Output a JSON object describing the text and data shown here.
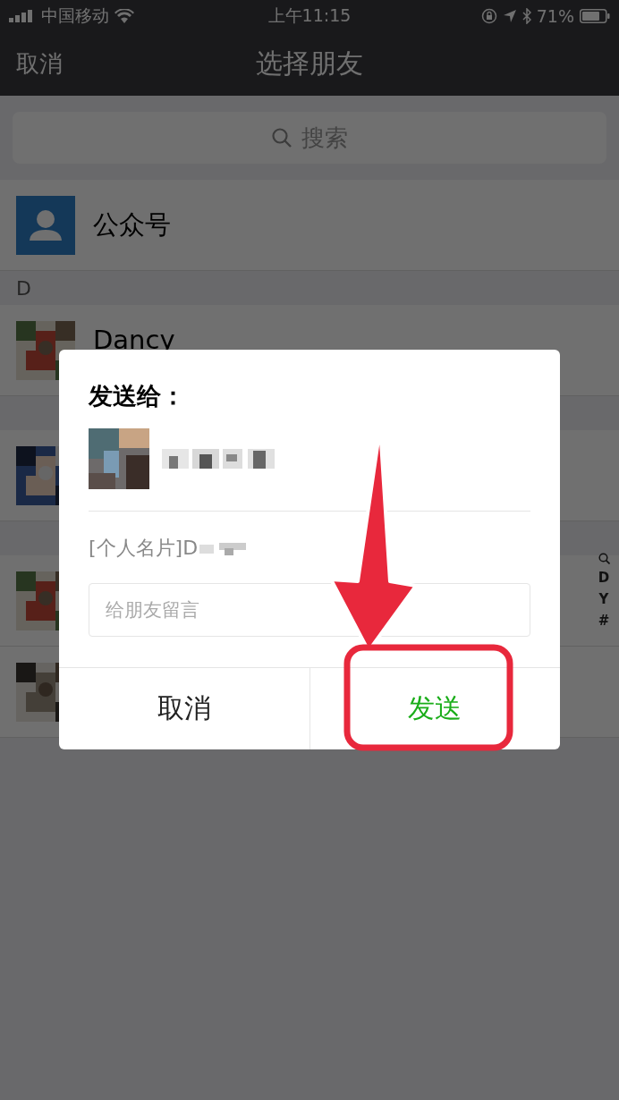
{
  "status_bar": {
    "carrier": "中国移动",
    "time": "上午11:15",
    "battery": "71%"
  },
  "nav": {
    "left": "取消",
    "title": "选择朋友"
  },
  "search": {
    "placeholder": "搜索"
  },
  "official_accounts": {
    "label": "公众号"
  },
  "list": [
    {
      "kind": "header",
      "label": "D"
    },
    {
      "kind": "contact",
      "name": "Dancy"
    },
    {
      "kind": "header"
    },
    {
      "kind": "contact"
    },
    {
      "kind": "header"
    },
    {
      "kind": "contact"
    },
    {
      "kind": "contact"
    }
  ],
  "index_bar": [
    "D",
    "Y",
    "#"
  ],
  "dialog": {
    "title": "发送给：",
    "card_text": "[个人名片]D",
    "message": {
      "placeholder": "给朋友留言"
    },
    "buttons": [
      {
        "kind": "cancel",
        "label": "取消"
      },
      {
        "kind": "confirm",
        "label": "发送"
      }
    ]
  }
}
